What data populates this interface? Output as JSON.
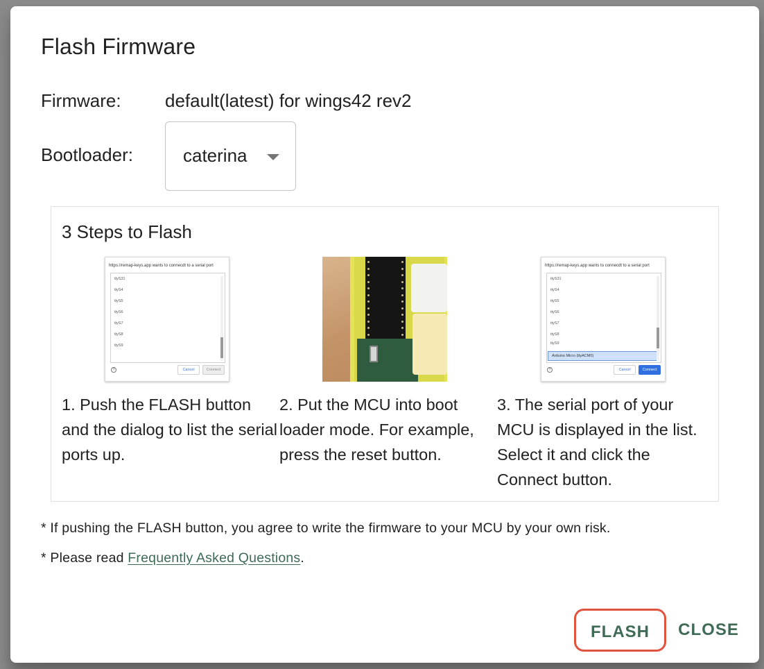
{
  "dialog": {
    "title": "Flash Firmware",
    "firmware_label": "Firmware:",
    "firmware_value": "default(latest) for wings42 rev2",
    "bootloader_label": "Bootloader:",
    "bootloader_value": "caterina"
  },
  "steps": {
    "title": "3 Steps to Flash",
    "items": [
      {
        "text": "1. Push the FLASH button and the dialog to list the serial ports up."
      },
      {
        "text": "2. Put the MCU into boot loader mode. For example, press the reset button."
      },
      {
        "text": "3. The serial port of your MCU is displayed in the list. Select it and click the Connect button."
      }
    ],
    "serial_dialog": {
      "header": "https://remap-keys.app wants to connecdt to a serial port",
      "ports": [
        "ttyS31",
        "ttyS4",
        "ttyS5",
        "ttyS6",
        "ttyS7",
        "ttyS8",
        "ttyS9"
      ],
      "selected_port": "Arduino Micro   (ttyACM0)",
      "help": "?",
      "cancel": "Cancel",
      "connect": "Connect"
    }
  },
  "notes": {
    "risk": "* If pushing the FLASH button, you agree to write the firmware to your MCU by your own risk.",
    "faq_prefix": "* Please read ",
    "faq_link": "Frequently Asked Questions",
    "faq_suffix": "."
  },
  "actions": {
    "flash": "FLASH",
    "close": "CLOSE"
  },
  "colors": {
    "accent": "#3f6b56",
    "highlight": "#e0533c"
  }
}
